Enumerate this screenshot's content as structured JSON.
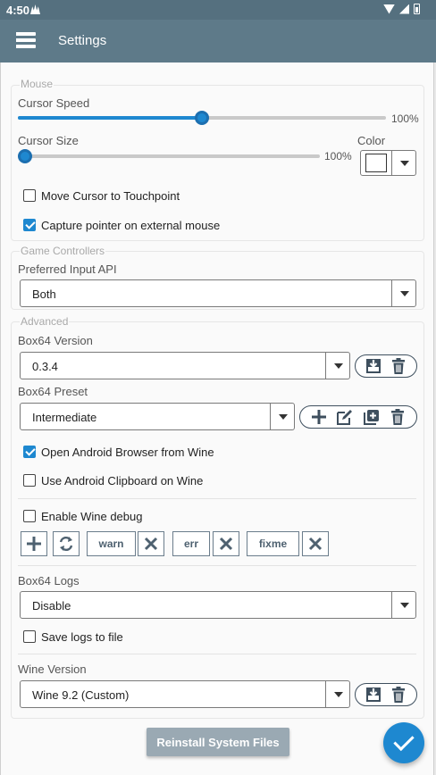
{
  "status": {
    "time": "4:50"
  },
  "appbar": {
    "title": "Settings"
  },
  "mouse": {
    "legend": "Mouse",
    "cursor_speed_label": "Cursor Speed",
    "cursor_speed_value": "100%",
    "cursor_speed_level": 0.5,
    "cursor_size_label": "Cursor Size",
    "cursor_size_value": "100%",
    "cursor_size_level": 0.0,
    "color_label": "Color",
    "color_value": "#ffffff",
    "move_cursor_label": "Move Cursor to Touchpoint",
    "move_cursor_checked": false,
    "capture_pointer_label": "Capture pointer on external mouse",
    "capture_pointer_checked": true
  },
  "game_controllers": {
    "legend": "Game Controllers",
    "input_api_label": "Preferred Input API",
    "input_api_value": "Both"
  },
  "advanced": {
    "legend": "Advanced",
    "box64_version_label": "Box64 Version",
    "box64_version_value": "0.3.4",
    "box64_preset_label": "Box64 Preset",
    "box64_preset_value": "Intermediate",
    "open_browser_label": "Open Android Browser from Wine",
    "open_browser_checked": true,
    "clipboard_label": "Use Android Clipboard on Wine",
    "clipboard_checked": false,
    "wine_debug_label": "Enable Wine debug",
    "wine_debug_checked": false,
    "debug_channels": [
      "warn",
      "err",
      "fixme"
    ],
    "box64_logs_label": "Box64 Logs",
    "box64_logs_value": "Disable",
    "save_logs_label": "Save logs to file",
    "save_logs_checked": false,
    "wine_version_label": "Wine Version",
    "wine_version_value": "Wine 9.2 (Custom)"
  },
  "actions": {
    "reinstall_label": "Reinstall System Files"
  },
  "colors": {
    "accent": "#1e88d0",
    "appbar": "#5e7a89",
    "statusbar": "#55707f"
  }
}
